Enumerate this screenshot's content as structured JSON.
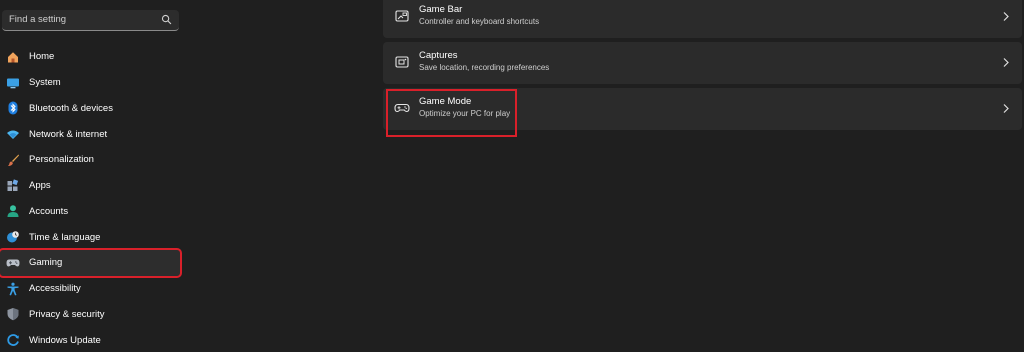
{
  "search": {
    "placeholder": "Find a setting",
    "icon": "search-icon"
  },
  "sidebar": {
    "items": [
      {
        "label": "Home",
        "icon": "home-icon"
      },
      {
        "label": "System",
        "icon": "monitor-icon"
      },
      {
        "label": "Bluetooth & devices",
        "icon": "bluetooth-icon"
      },
      {
        "label": "Network & internet",
        "icon": "wifi-icon"
      },
      {
        "label": "Personalization",
        "icon": "brush-icon"
      },
      {
        "label": "Apps",
        "icon": "apps-icon"
      },
      {
        "label": "Accounts",
        "icon": "person-icon"
      },
      {
        "label": "Time & language",
        "icon": "globe-clock-icon"
      },
      {
        "label": "Gaming",
        "icon": "gamepad-icon",
        "selected": true
      },
      {
        "label": "Accessibility",
        "icon": "accessibility-icon"
      },
      {
        "label": "Privacy & security",
        "icon": "shield-icon"
      },
      {
        "label": "Windows Update",
        "icon": "update-icon"
      }
    ]
  },
  "main": {
    "cards": [
      {
        "title": "Game Bar",
        "subtitle": "Controller and keyboard shortcuts",
        "icon": "game-bar-icon"
      },
      {
        "title": "Captures",
        "subtitle": "Save location, recording preferences",
        "icon": "capture-icon"
      },
      {
        "title": "Game Mode",
        "subtitle": "Optimize your PC for play",
        "icon": "gamepad-icon",
        "highlighted": true
      }
    ]
  },
  "colors": {
    "background": "#1f1f1f",
    "card": "#2b2b2b",
    "highlight": "#d9202a",
    "accent": "#4cc2ff"
  }
}
